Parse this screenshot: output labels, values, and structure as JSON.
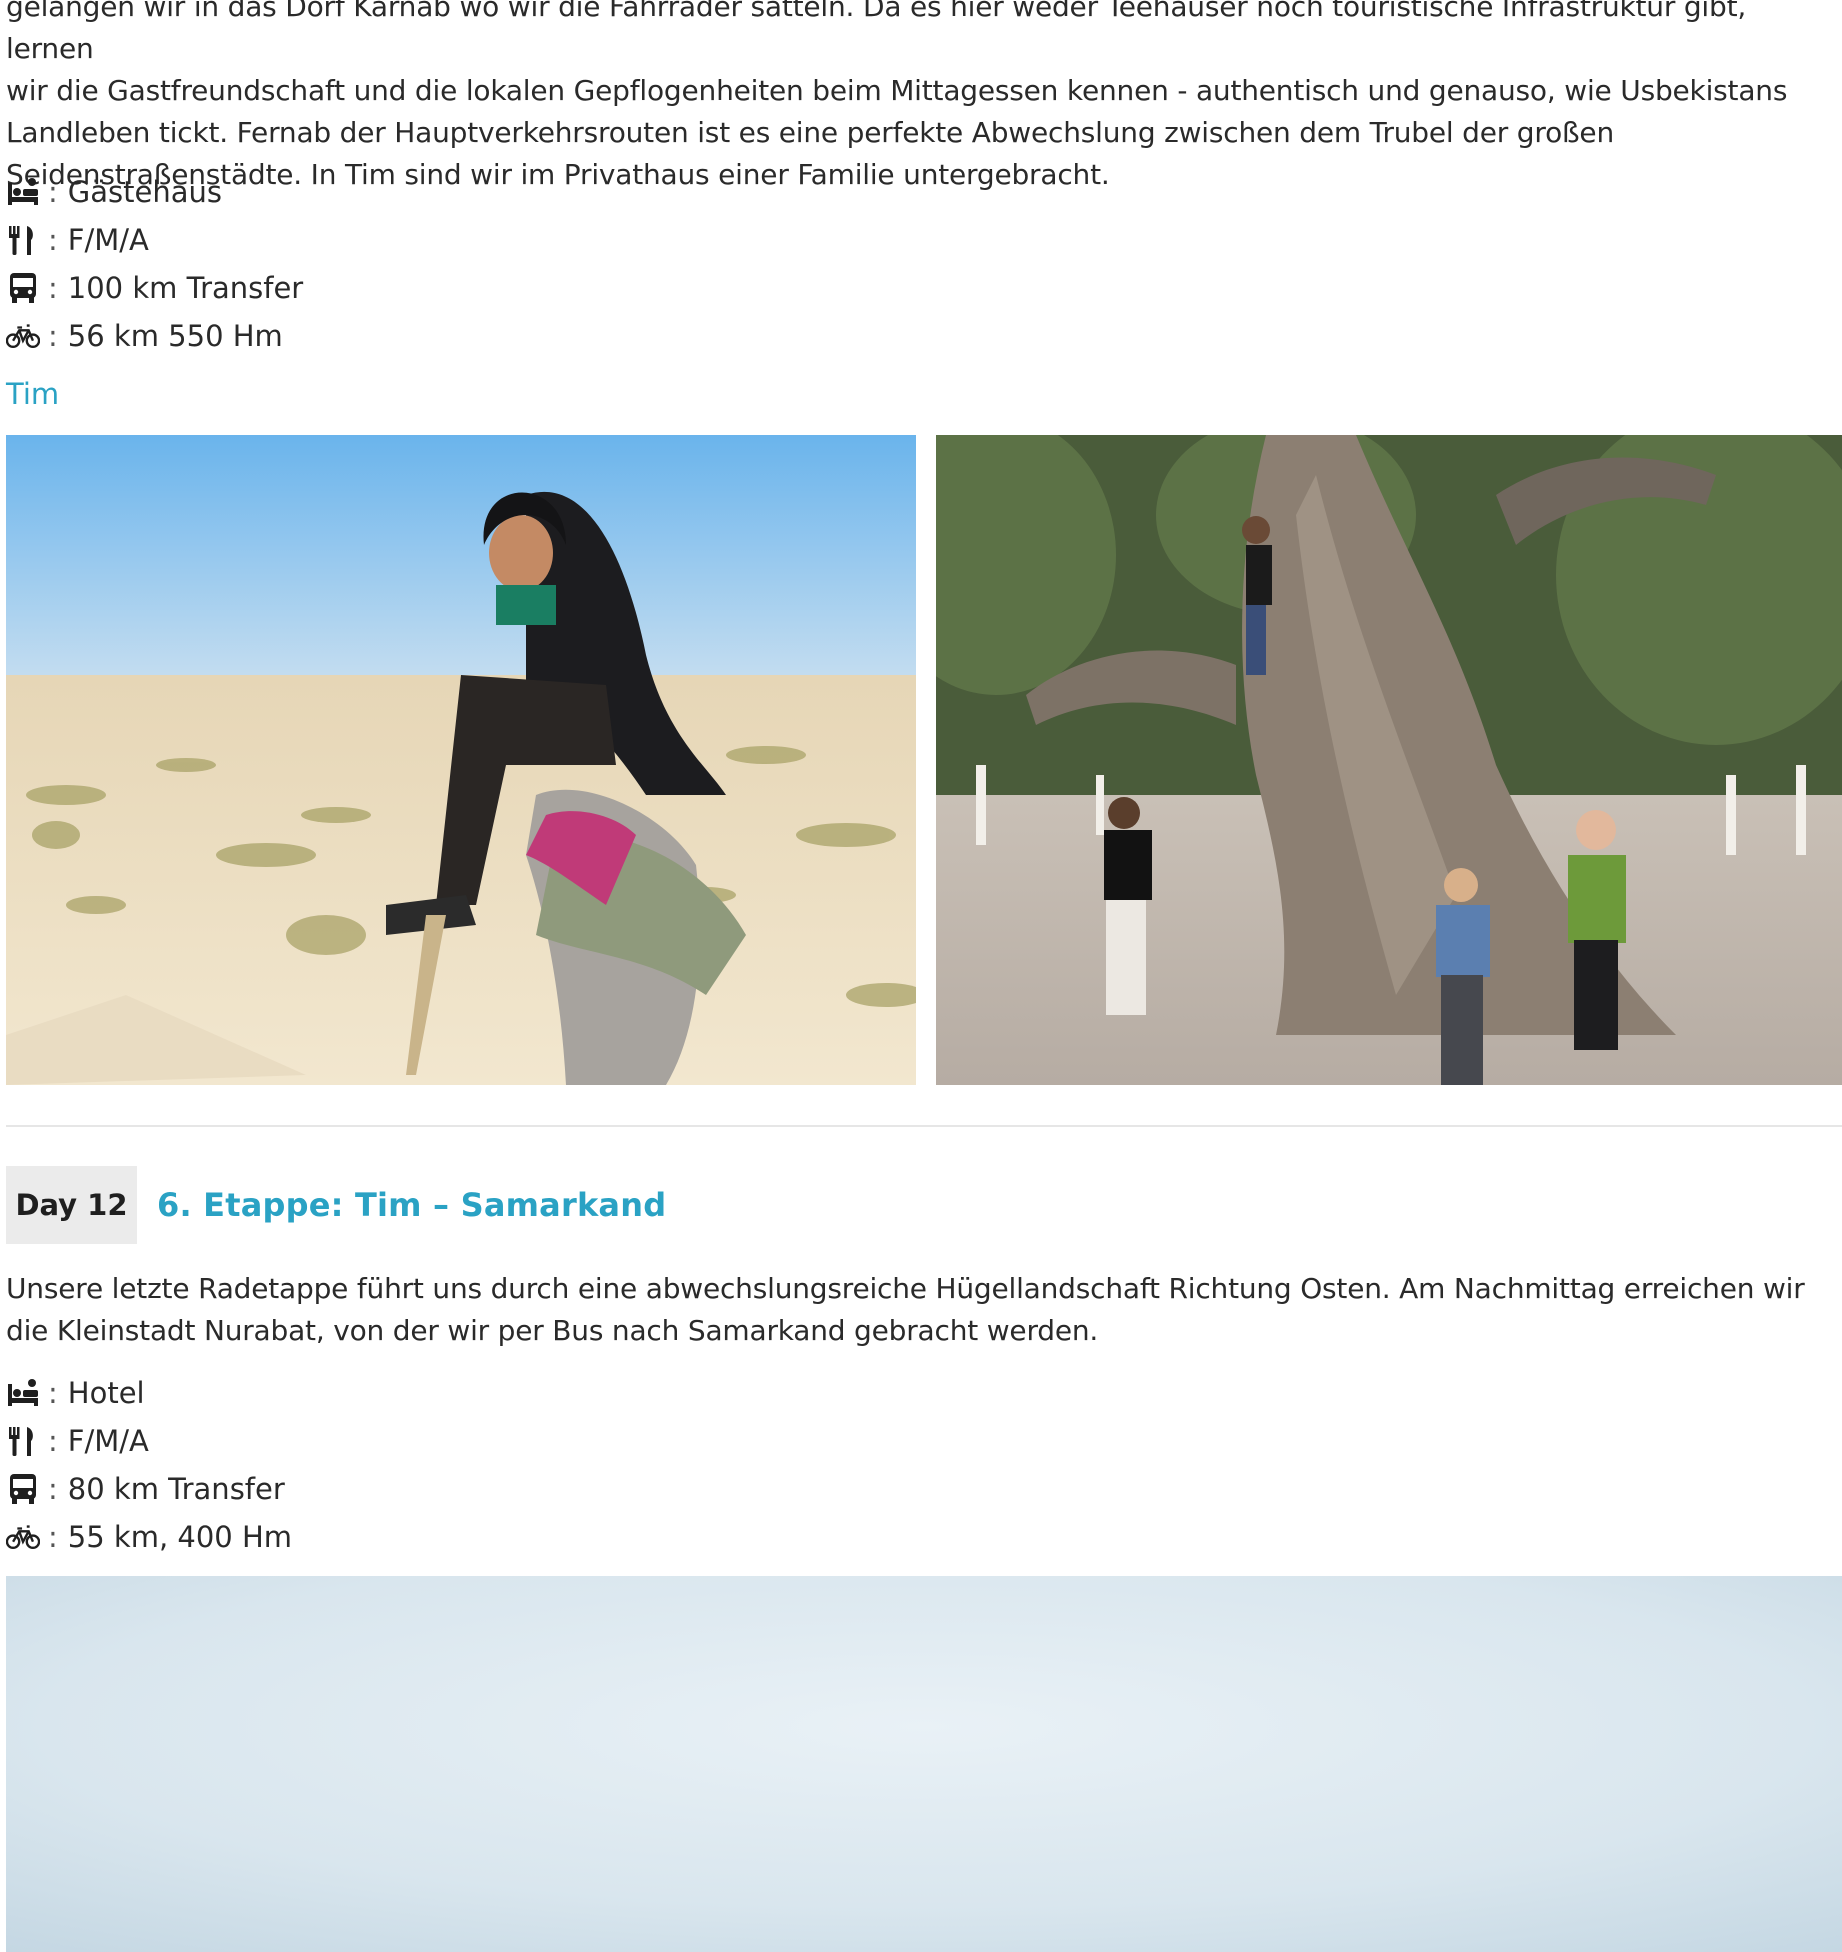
{
  "day11": {
    "paragraph_lines": [
      "gelangen wir in das Dorf Karnab wo wir die Fahrräder satteln. Da es hier weder Teehäuser noch touristische Infrastruktur gibt, lernen",
      "wir die Gastfreundschaft und die lokalen Gepflogenheiten beim Mittagessen kennen - authentisch und genauso, wie Usbekistans",
      "Landleben tickt. Fernab der Hauptverkehrsrouten ist es eine perfekte Abwechslung zwischen dem Trubel der großen",
      "Seidenstraßenstädte. In Tim sind wir im Privathaus einer Familie untergebracht."
    ],
    "facts": [
      {
        "icon": "bed-icon",
        "text": "Gästehaus"
      },
      {
        "icon": "cutlery-icon",
        "text": "F/M/A"
      },
      {
        "icon": "bus-icon",
        "text": "100 km Transfer"
      },
      {
        "icon": "bicycle-icon",
        "text": "56 km 550 Hm"
      }
    ],
    "place_link": "Tim"
  },
  "day12": {
    "badge": "Day 12",
    "title": "6. Etappe: Tim – Samarkand",
    "paragraph_lines": [
      "Unsere letzte Radetappe führt uns durch eine abwechslungsreiche Hügellandschaft Richtung Osten. Am Nachmittag erreichen wir",
      "die Kleinstadt Nurabat, von der wir per Bus nach Samarkand gebracht werden."
    ],
    "facts": [
      {
        "icon": "bed-icon",
        "text": "Hotel"
      },
      {
        "icon": "cutlery-icon",
        "text": "F/M/A"
      },
      {
        "icon": "bus-icon",
        "text": "80 km Transfer"
      },
      {
        "icon": "bicycle-icon",
        "text": "55 km, 400 Hm"
      }
    ]
  },
  "fact_separator": ":",
  "colors": {
    "accent": "#2aa2c4",
    "badge_bg": "#ebebeb",
    "text": "#2a2a2a"
  }
}
